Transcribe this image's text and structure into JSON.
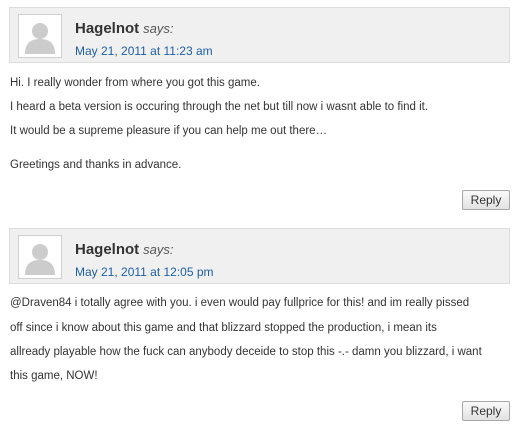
{
  "comments": [
    {
      "author": "Hagelnot",
      "says": "says:",
      "date": "May 21, 2011 at 11:23 am",
      "lines": [
        "Hi. I really wonder from where you got this game.",
        "I heard a beta version is occuring through the net but till now i wasnt able to find it.",
        "It would be a supreme pleasure if you can help me out there…",
        "Greetings and thanks in advance."
      ],
      "reply_label": "Reply"
    },
    {
      "author": "Hagelnot",
      "says": "says:",
      "date": "May 21, 2011 at 12:05 pm",
      "lines": [
        "@Draven84 i totally agree with you. i even would pay fullprice for this! and im really pissed",
        "off since i know about this game and that blizzard stopped the production, i mean its",
        "allready playable how the fuck can anybody deceide to stop this -.- damn you blizzard, i want",
        "this game, NOW!"
      ],
      "reply_label": "Reply"
    }
  ]
}
